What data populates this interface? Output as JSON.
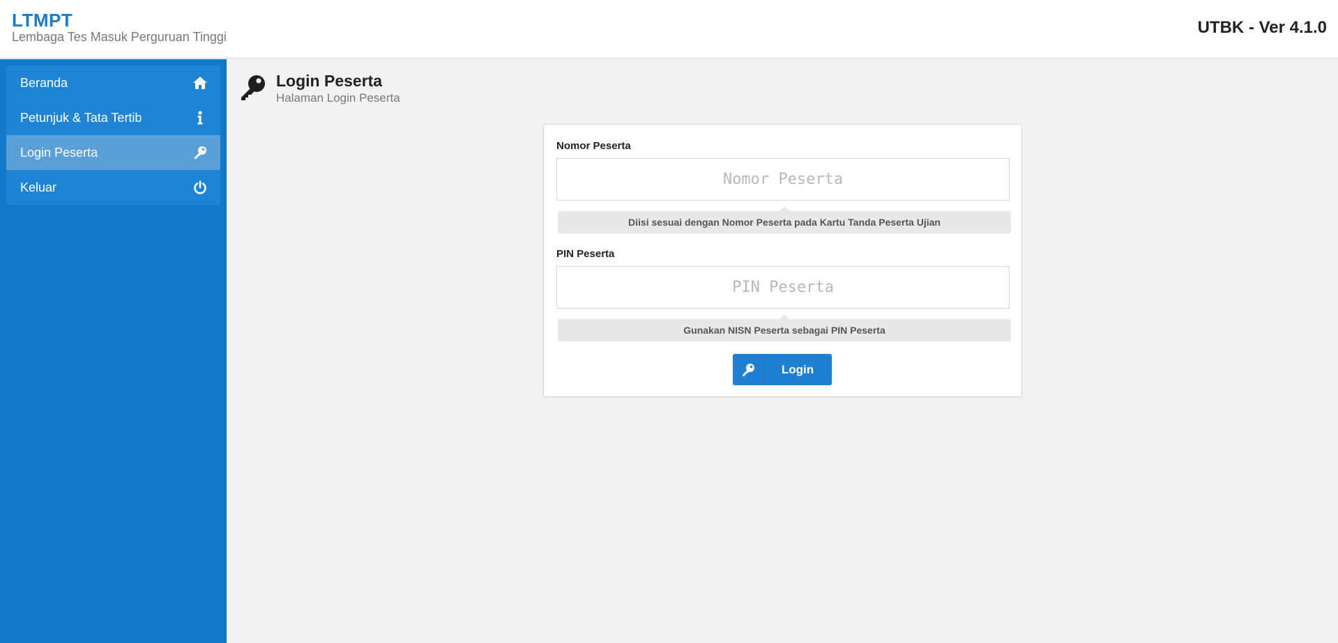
{
  "header": {
    "brand_title": "LTMPT",
    "brand_subtitle": "Lembaga Tes Masuk Perguruan Tinggi",
    "version": "UTBK - Ver 4.1.0"
  },
  "sidebar": {
    "items": [
      {
        "label": "Beranda",
        "icon": "home-icon"
      },
      {
        "label": "Petunjuk & Tata Tertib",
        "icon": "info-icon"
      },
      {
        "label": "Login Peserta",
        "icon": "key-icon",
        "active": true
      },
      {
        "label": "Keluar",
        "icon": "power-icon"
      }
    ]
  },
  "page": {
    "title": "Login Peserta",
    "subtitle": "Halaman Login Peserta"
  },
  "form": {
    "nomor_label": "Nomor Peserta",
    "nomor_placeholder": "Nomor Peserta",
    "nomor_value": "",
    "nomor_hint": "Diisi sesuai dengan Nomor Peserta pada Kartu Tanda Peserta Ujian",
    "pin_label": "PIN Peserta",
    "pin_placeholder": "PIN Peserta",
    "pin_value": "",
    "pin_hint": "Gunakan NISN Peserta sebagai PIN Peserta",
    "login_label": "Login"
  },
  "colors": {
    "accent": "#1f7fd2",
    "sidebar_bg": "#1478c8",
    "active_item": "#5a9fd8",
    "brand": "#1a7bcb"
  }
}
